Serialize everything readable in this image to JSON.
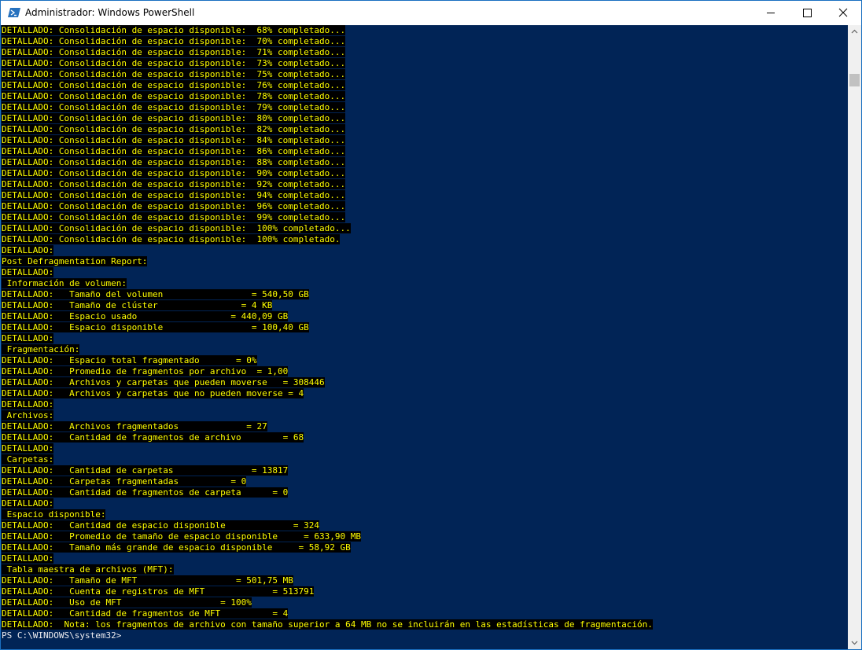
{
  "window": {
    "title": "Administrador: Windows PowerShell",
    "controls": {
      "minimize": "minimize",
      "maximize": "maximize",
      "close": "close"
    }
  },
  "colors": {
    "console_bg": "#012456",
    "verbose_fg": "#ffff00",
    "verbose_bg": "#000000",
    "prompt_fg": "#eeedf0"
  },
  "console": {
    "lines": [
      "DETALLADO: Consolidación de espacio disponible:  68% completado...",
      "DETALLADO: Consolidación de espacio disponible:  70% completado...",
      "DETALLADO: Consolidación de espacio disponible:  71% completado...",
      "DETALLADO: Consolidación de espacio disponible:  73% completado...",
      "DETALLADO: Consolidación de espacio disponible:  75% completado...",
      "DETALLADO: Consolidación de espacio disponible:  76% completado...",
      "DETALLADO: Consolidación de espacio disponible:  78% completado...",
      "DETALLADO: Consolidación de espacio disponible:  79% completado...",
      "DETALLADO: Consolidación de espacio disponible:  80% completado...",
      "DETALLADO: Consolidación de espacio disponible:  82% completado...",
      "DETALLADO: Consolidación de espacio disponible:  84% completado...",
      "DETALLADO: Consolidación de espacio disponible:  86% completado...",
      "DETALLADO: Consolidación de espacio disponible:  88% completado...",
      "DETALLADO: Consolidación de espacio disponible:  90% completado...",
      "DETALLADO: Consolidación de espacio disponible:  92% completado...",
      "DETALLADO: Consolidación de espacio disponible:  94% completado...",
      "DETALLADO: Consolidación de espacio disponible:  96% completado...",
      "DETALLADO: Consolidación de espacio disponible:  99% completado...",
      "DETALLADO: Consolidación de espacio disponible:  100% completado...",
      "DETALLADO: Consolidación de espacio disponible:  100% completado.",
      "DETALLADO:",
      "Post Defragmentation Report:",
      "DETALLADO:",
      " Información de volumen:",
      "DETALLADO:   Tamaño del volumen                 = 540,50 GB",
      "DETALLADO:   Tamaño de clúster                = 4 KB",
      "DETALLADO:   Espacio usado                  = 440,09 GB",
      "DETALLADO:   Espacio disponible                 = 100,40 GB",
      "DETALLADO:",
      " Fragmentación:",
      "DETALLADO:   Espacio total fragmentado       = 0%",
      "DETALLADO:   Promedio de fragmentos por archivo  = 1,00",
      "DETALLADO:   Archivos y carpetas que pueden moverse   = 308446",
      "DETALLADO:   Archivos y carpetas que no pueden moverse = 4",
      "DETALLADO:",
      " Archivos:",
      "DETALLADO:   Archivos fragmentados             = 27",
      "DETALLADO:   Cantidad de fragmentos de archivo        = 68",
      "DETALLADO:",
      " Carpetas:",
      "DETALLADO:   Cantidad de carpetas               = 13817",
      "DETALLADO:   Carpetas fragmentadas          = 0",
      "DETALLADO:   Cantidad de fragmentos de carpeta      = 0",
      "DETALLADO:",
      " Espacio disponible:",
      "DETALLADO:   Cantidad de espacio disponible             = 324",
      "DETALLADO:   Promedio de tamaño de espacio disponible     = 633,90 MB",
      "DETALLADO:   Tamaño más grande de espacio disponible     = 58,92 GB",
      "DETALLADO:",
      " Tabla maestra de archivos (MFT):",
      "DETALLADO:   Tamaño de MFT                   = 501,75 MB",
      "DETALLADO:   Cuenta de registros de MFT             = 513791",
      "DETALLADO:   Uso de MFT                   = 100%",
      "DETALLADO:   Cantidad de fragmentos de MFT          = 4",
      "DETALLADO:  Nota: los fragmentos de archivo con tamaño superior a 64 MB no se incluirán en las estadísticas de fragmentación."
    ],
    "prompt": "PS C:\\WINDOWS\\system32>"
  },
  "scrollbar": {
    "position": 0.08
  }
}
